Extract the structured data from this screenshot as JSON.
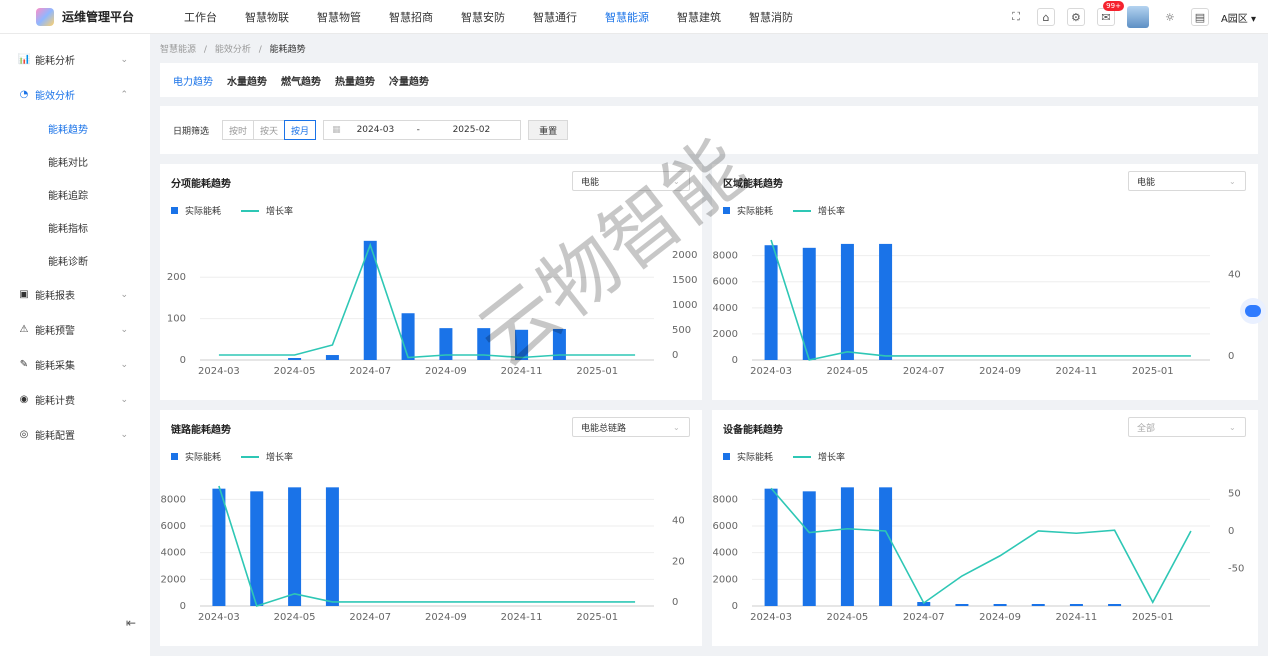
{
  "app": {
    "title": "运维管理平台"
  },
  "nav": [
    {
      "label": "工作台"
    },
    {
      "label": "智慧物联"
    },
    {
      "label": "智慧物管"
    },
    {
      "label": "智慧招商"
    },
    {
      "label": "智慧安防"
    },
    {
      "label": "智慧通行"
    },
    {
      "label": "智慧能源",
      "active": true
    },
    {
      "label": "智慧建筑"
    },
    {
      "label": "智慧消防"
    }
  ],
  "topright": {
    "badge": "99+",
    "park": "A园区 ▾"
  },
  "sidebar": {
    "items": [
      {
        "label": "能耗分析"
      },
      {
        "label": "能效分析",
        "open": true
      },
      {
        "label": "能耗报表"
      },
      {
        "label": "能耗预警"
      },
      {
        "label": "能耗采集"
      },
      {
        "label": "能耗计费"
      },
      {
        "label": "能耗配置"
      }
    ],
    "subitems": [
      {
        "label": "能耗趋势",
        "active": true
      },
      {
        "label": "能耗对比"
      },
      {
        "label": "能耗追踪"
      },
      {
        "label": "能耗指标"
      },
      {
        "label": "能耗诊断"
      }
    ]
  },
  "breadcrumb": {
    "p1": "智慧能源",
    "p2": "能效分析",
    "current": "能耗趋势",
    "sep": "/"
  },
  "tabs": [
    {
      "label": "电力趋势",
      "active": true
    },
    {
      "label": "水量趋势"
    },
    {
      "label": "燃气趋势"
    },
    {
      "label": "热量趋势"
    },
    {
      "label": "冷量趋势"
    }
  ],
  "filter": {
    "label": "日期筛选",
    "modes": [
      {
        "label": "按时"
      },
      {
        "label": "按天"
      },
      {
        "label": "按月",
        "active": true
      }
    ],
    "start": "2024-03",
    "sep": "-",
    "end": "2025-02",
    "reset": "重置"
  },
  "watermark": "云物智能",
  "legend": {
    "bar": "实际能耗",
    "line": "增长率"
  },
  "colors": {
    "accent": "#1a73e8",
    "bar": "#1a73e8",
    "line": "#2ec7b5"
  },
  "chart_data": [
    {
      "type": "bar",
      "title": "分项能耗趋势",
      "select": "电能",
      "categories": [
        "2024-03",
        "2024-04",
        "2024-05",
        "2024-06",
        "2024-07",
        "2024-08",
        "2024-09",
        "2024-10",
        "2024-11",
        "2024-12",
        "2025-01",
        "2025-02"
      ],
      "x_tick_labels": [
        "2024-03",
        "2024-05",
        "2024-07",
        "2024-09",
        "2024-11",
        "2025-01"
      ],
      "series": [
        {
          "name": "实际能耗",
          "type": "bar",
          "axis": "left",
          "values": [
            0,
            0,
            2,
            12,
            288,
            113,
            77,
            77,
            73,
            75,
            0,
            0
          ]
        },
        {
          "name": "增长率",
          "type": "line",
          "axis": "right",
          "values": [
            0,
            0,
            0,
            200,
            2200,
            -50,
            0,
            0,
            -50,
            0,
            0,
            0
          ]
        }
      ],
      "y_left": {
        "ticks": [
          0,
          100,
          200
        ],
        "min": 0,
        "max": 290
      },
      "y_right": {
        "ticks": [
          0,
          500,
          1000,
          1500,
          2000
        ],
        "min": -100,
        "max": 2300
      }
    },
    {
      "type": "bar",
      "title": "区域能耗趋势",
      "select": "电能",
      "categories": [
        "2024-03",
        "2024-04",
        "2024-05",
        "2024-06",
        "2024-07",
        "2024-08",
        "2024-09",
        "2024-10",
        "2024-11",
        "2024-12",
        "2025-01",
        "2025-02"
      ],
      "x_tick_labels": [
        "2024-03",
        "2024-05",
        "2024-07",
        "2024-09",
        "2024-11",
        "2025-01"
      ],
      "series": [
        {
          "name": "实际能耗",
          "type": "bar",
          "axis": "left",
          "values": [
            8800,
            8600,
            8900,
            8900,
            0,
            0,
            0,
            0,
            0,
            0,
            0,
            0
          ]
        },
        {
          "name": "增长率",
          "type": "line",
          "axis": "right",
          "values": [
            57,
            -2,
            2,
            0,
            0,
            0,
            0,
            0,
            0,
            0,
            0,
            0
          ]
        }
      ],
      "y_left": {
        "ticks": [
          0,
          2000,
          4000,
          6000,
          8000
        ],
        "min": 0,
        "max": 9200
      },
      "y_right": {
        "ticks": [
          0,
          40
        ],
        "min": -2,
        "max": 57
      }
    },
    {
      "type": "bar",
      "title": "链路能耗趋势",
      "select": "电能总链路",
      "categories": [
        "2024-03",
        "2024-04",
        "2024-05",
        "2024-06",
        "2024-07",
        "2024-08",
        "2024-09",
        "2024-10",
        "2024-11",
        "2024-12",
        "2025-01",
        "2025-02"
      ],
      "x_tick_labels": [
        "2024-03",
        "2024-05",
        "2024-07",
        "2024-09",
        "2024-11",
        "2025-01"
      ],
      "series": [
        {
          "name": "实际能耗",
          "type": "bar",
          "axis": "left",
          "values": [
            8800,
            8600,
            8900,
            8900,
            0,
            0,
            0,
            0,
            0,
            0,
            0,
            0
          ]
        },
        {
          "name": "增长率",
          "type": "line",
          "axis": "right",
          "values": [
            57,
            -2,
            4,
            0,
            0,
            0,
            0,
            0,
            0,
            0,
            0,
            0
          ]
        }
      ],
      "y_left": {
        "ticks": [
          0,
          2000,
          4000,
          6000,
          8000
        ],
        "min": 0,
        "max": 9000
      },
      "y_right": {
        "ticks": [
          0,
          20,
          40
        ],
        "min": -2,
        "max": 57
      }
    },
    {
      "type": "bar",
      "title": "设备能耗趋势",
      "select": "全部",
      "select_placeholder": true,
      "categories": [
        "2024-03",
        "2024-04",
        "2024-05",
        "2024-06",
        "2024-07",
        "2024-08",
        "2024-09",
        "2024-10",
        "2024-11",
        "2024-12",
        "2025-01",
        "2025-02"
      ],
      "x_tick_labels": [
        "2024-03",
        "2024-05",
        "2024-07",
        "2024-09",
        "2024-11",
        "2025-01"
      ],
      "series": [
        {
          "name": "实际能耗",
          "type": "bar",
          "axis": "left",
          "values": [
            8800,
            8600,
            8900,
            8900,
            300,
            100,
            50,
            50,
            50,
            50,
            0,
            0
          ]
        },
        {
          "name": "增长率",
          "type": "line",
          "axis": "right",
          "values": [
            57,
            -2,
            3,
            0,
            -96,
            -60,
            -33,
            0,
            -3,
            1,
            -95,
            0
          ]
        }
      ],
      "y_left": {
        "ticks": [
          0,
          2000,
          4000,
          6000,
          8000
        ],
        "min": 0,
        "max": 9000
      },
      "y_right": {
        "ticks": [
          -50,
          0,
          50
        ],
        "min": -100,
        "max": 60
      }
    }
  ]
}
